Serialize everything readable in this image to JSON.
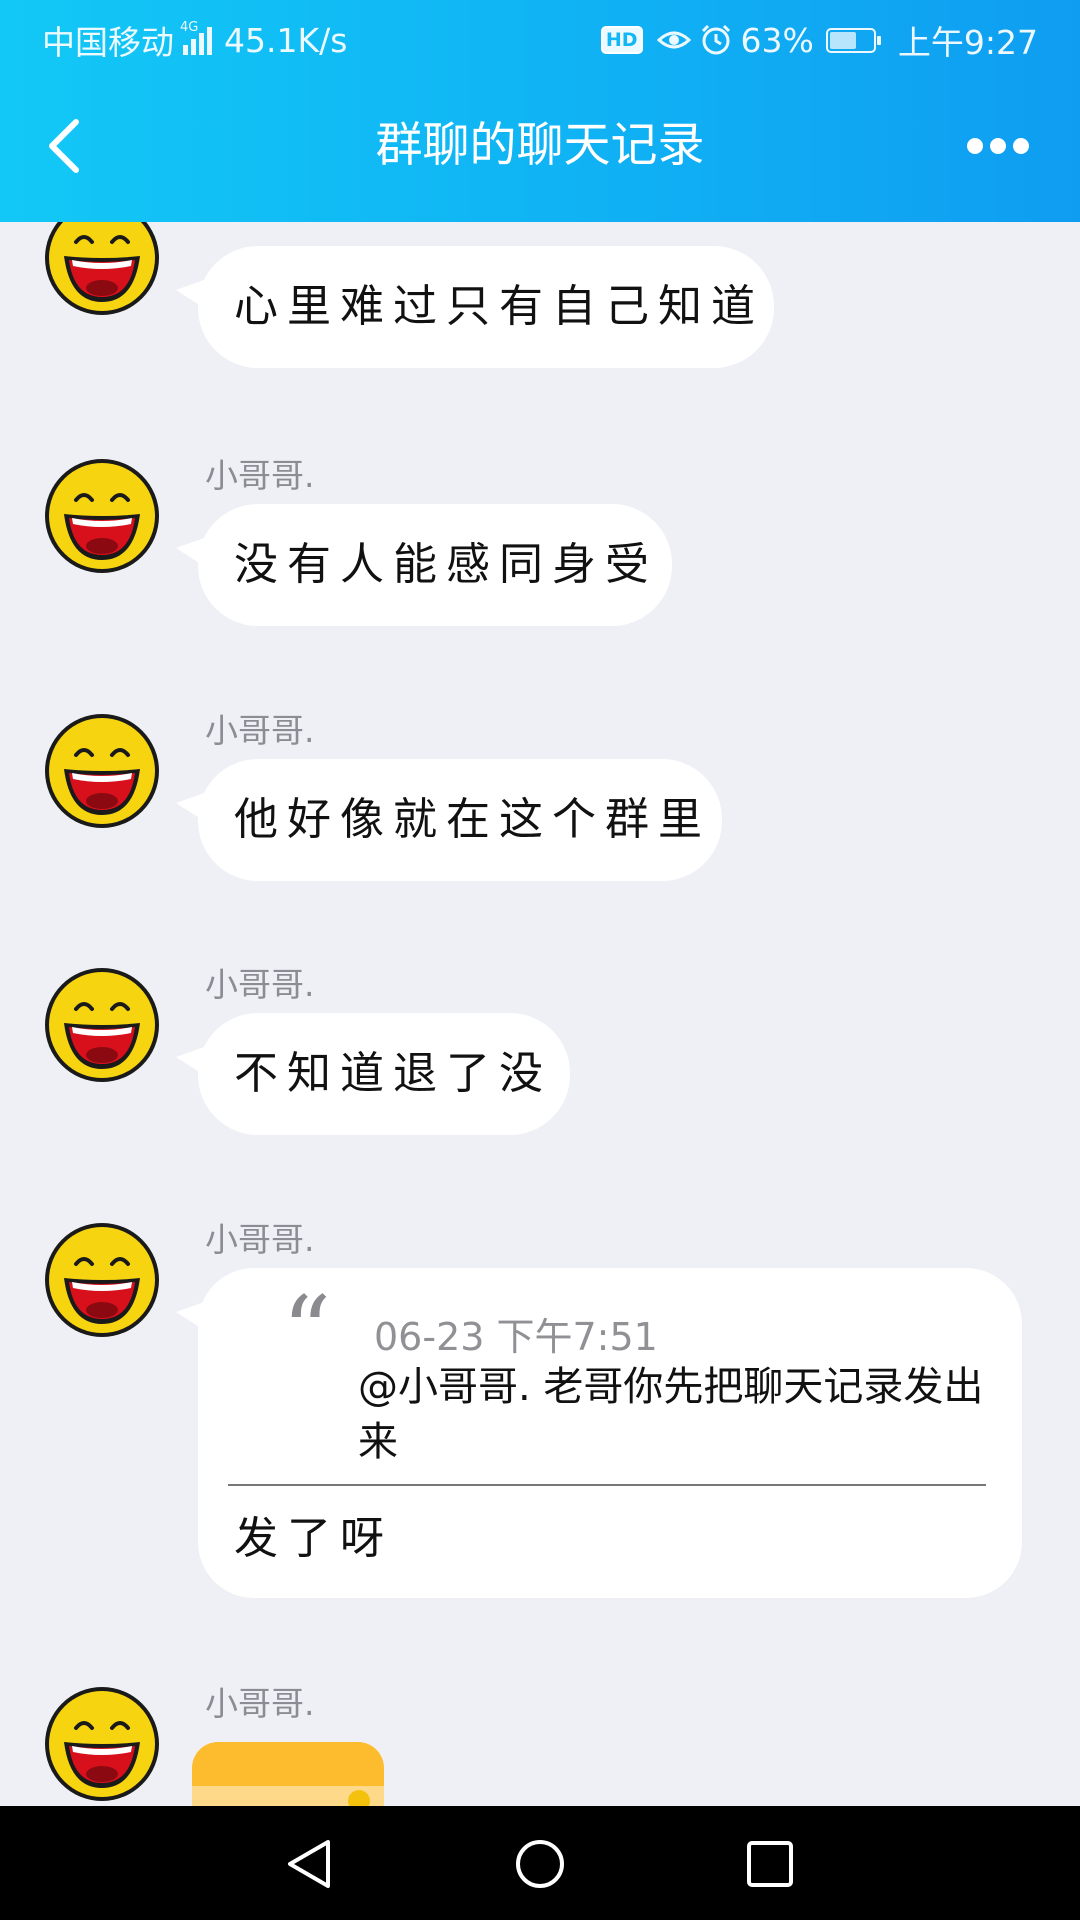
{
  "status_bar": {
    "carrier": "中国移动",
    "network_type": "4G",
    "speed": "45.1K/s",
    "hd": "HD",
    "battery_percent": "63%",
    "battery_level": 0.63,
    "time": "上午9:27"
  },
  "header": {
    "title": "群聊的聊天记录",
    "back_icon": "chevron-left-icon",
    "more_icon": "more-horizontal-icon"
  },
  "messages": [
    {
      "sender": "",
      "text": "心里难过只有自己知道"
    },
    {
      "sender": "小哥哥.",
      "text": "没有人能感同身受"
    },
    {
      "sender": "小哥哥.",
      "text": "他好像就在这个群里"
    },
    {
      "sender": "小哥哥.",
      "text": "不知道退了没"
    },
    {
      "sender": "小哥哥.",
      "quote": {
        "mark": "“",
        "time": "06-23 下午7:51",
        "text": "@小哥哥. 老哥你先把聊天记录发出来"
      },
      "text": "发了呀"
    },
    {
      "sender": "小哥哥.",
      "image": "screenshot-thumbnail"
    }
  ],
  "colors": {
    "header_start": "#12c8f6",
    "header_end": "#0f9df1",
    "chat_background": "#eff0f5",
    "bubble": "#ffffff"
  }
}
